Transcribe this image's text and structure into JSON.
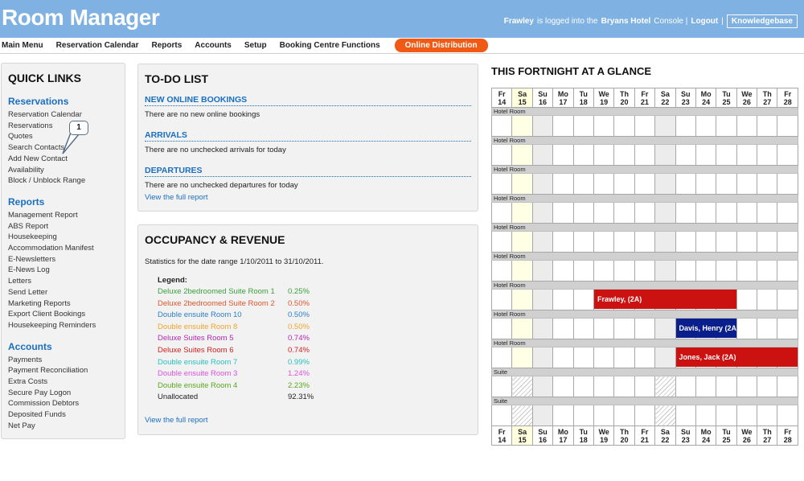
{
  "header": {
    "logo": "Room Manager",
    "user": "Frawley",
    "logged_text": "is logged into the",
    "hotel": "Bryans Hotel",
    "console_text": "Console |",
    "logout": "Logout",
    "sep": "|",
    "knowledgebase": "Knowledgebase"
  },
  "nav": {
    "items": [
      "Main Menu",
      "Reservation Calendar",
      "Reports",
      "Accounts",
      "Setup",
      "Booking Centre Functions"
    ],
    "online": "Online Distribution"
  },
  "quick_links": {
    "title": "QUICK LINKS",
    "sections": [
      {
        "title": "Reservations",
        "links": [
          "Reservation Calendar",
          "Reservations",
          "Quotes",
          "Search Contacts",
          "Add New Contact",
          "Availability",
          "Block / Unblock Range"
        ]
      },
      {
        "title": "Reports",
        "links": [
          "Management Report",
          "ABS Report",
          "Housekeeping",
          "Accommodation Manifest",
          "E-Newsletters",
          "E-News Log",
          "Letters",
          "Send Letter",
          "Marketing Reports",
          "Export Client Bookings",
          "Housekeeping Reminders"
        ]
      },
      {
        "title": "Accounts",
        "links": [
          "Payments",
          "Payment Reconciliation",
          "Extra Costs",
          "Secure Pay Logon",
          "Commission Debtors",
          "Deposited Funds",
          "Net Pay"
        ]
      }
    ],
    "callout": "1"
  },
  "todo": {
    "title": "TO-DO LIST",
    "sections": [
      {
        "head": "NEW ONLINE BOOKINGS",
        "text": "There are no new online bookings"
      },
      {
        "head": "ARRIVALS",
        "text": "There are no unchecked arrivals for today"
      },
      {
        "head": "DEPARTURES",
        "text": "There are no unchecked departures for today"
      }
    ],
    "link": "View the full report"
  },
  "occupancy": {
    "title": "OCCUPANCY & REVENUE",
    "stats": "Statistics for the date range 1/10/2011 to 31/10/2011.",
    "legend_title": "Legend:",
    "legend": [
      {
        "name": "Deluxe 2bedroomed Suite Room 1",
        "value": "0.25%",
        "color": "#3aa03a"
      },
      {
        "name": "Deluxe 2bedroomed Suite Room 2",
        "value": "0.50%",
        "color": "#e0552a"
      },
      {
        "name": "Double ensuite Room 10",
        "value": "0.50%",
        "color": "#2a7fc8"
      },
      {
        "name": "Double ensuite Room 8",
        "value": "0.50%",
        "color": "#f0a52a"
      },
      {
        "name": "Deluxe Suites Room 5",
        "value": "0.74%",
        "color": "#b02ab0"
      },
      {
        "name": "Deluxe Suites Room 6",
        "value": "0.74%",
        "color": "#d42020"
      },
      {
        "name": "Double ensuite Room 7",
        "value": "0.99%",
        "color": "#28c0c0"
      },
      {
        "name": "Double ensuite Room 3",
        "value": "1.24%",
        "color": "#e050e0"
      },
      {
        "name": "Double ensuite Room 4",
        "value": "2.23%",
        "color": "#58a81e"
      },
      {
        "name": "Unallocated",
        "value": "92.31%",
        "color": "#222222"
      }
    ],
    "link": "View the full report"
  },
  "fortnight": {
    "title": "THIS FORTNIGHT AT A GLANCE",
    "days": [
      {
        "dow": "Fr",
        "day": "14"
      },
      {
        "dow": "Sa",
        "day": "15"
      },
      {
        "dow": "Su",
        "day": "16"
      },
      {
        "dow": "Mo",
        "day": "17"
      },
      {
        "dow": "Tu",
        "day": "18"
      },
      {
        "dow": "We",
        "day": "19"
      },
      {
        "dow": "Th",
        "day": "20"
      },
      {
        "dow": "Fr",
        "day": "21"
      },
      {
        "dow": "Sa",
        "day": "22"
      },
      {
        "dow": "Su",
        "day": "23"
      },
      {
        "dow": "Mo",
        "day": "24"
      },
      {
        "dow": "Tu",
        "day": "25"
      },
      {
        "dow": "We",
        "day": "26"
      },
      {
        "dow": "Th",
        "day": "27"
      },
      {
        "dow": "Fr",
        "day": "28"
      }
    ],
    "rooms": [
      {
        "type": "Hotel Room"
      },
      {
        "type": "Hotel Room"
      },
      {
        "type": "Hotel Room"
      },
      {
        "type": "Hotel Room"
      },
      {
        "type": "Hotel Room"
      },
      {
        "type": "Hotel Room"
      },
      {
        "type": "Hotel Room",
        "booking": {
          "label": "Frawley, (2A)",
          "start": 5,
          "span": 7,
          "color": "#cc1111"
        }
      },
      {
        "type": "Hotel Room",
        "booking": {
          "label": "Davis, Henry (2A",
          "start": 9,
          "span": 3,
          "color": "#0a1e8c"
        }
      },
      {
        "type": "Hotel Room",
        "booking": {
          "label": "Jones, Jack (2A)",
          "start": 9,
          "span": 6,
          "color": "#cc1111"
        }
      },
      {
        "type": "Suite",
        "hatch": true
      },
      {
        "type": "Suite",
        "hatch": true
      }
    ]
  }
}
